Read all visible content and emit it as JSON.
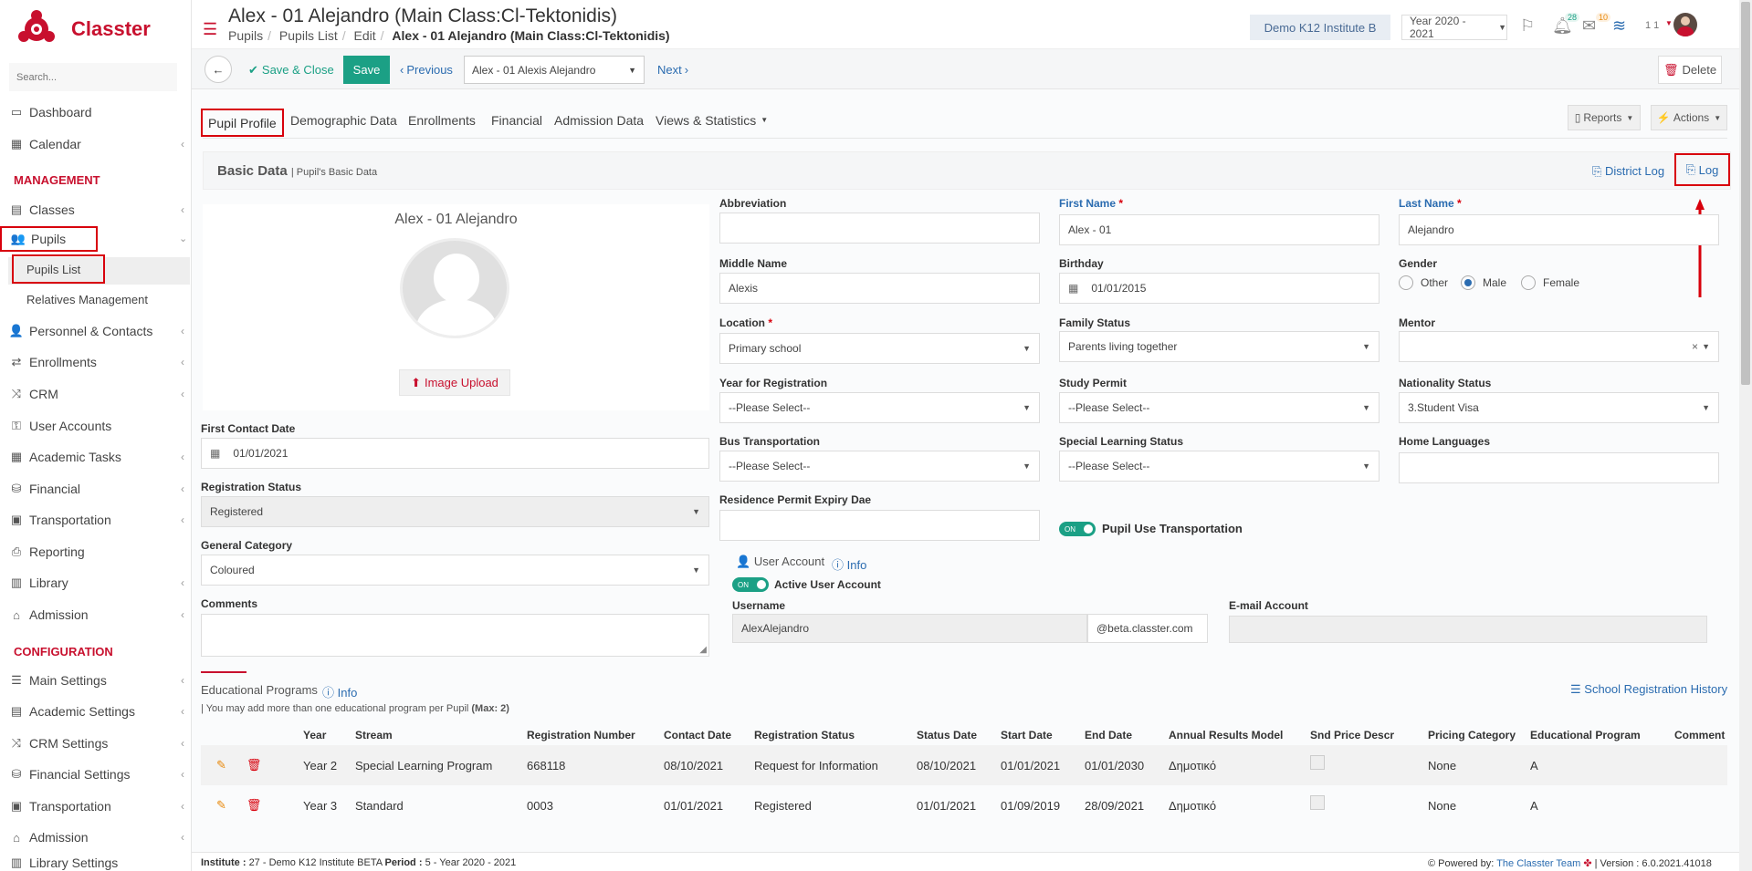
{
  "brand": {
    "name": "Classter"
  },
  "sidebar": {
    "search_placeholder": "Search...",
    "items": [
      {
        "label": "Dashboard"
      },
      {
        "label": "Calendar"
      },
      {
        "label": "Classes"
      },
      {
        "label": "Pupils"
      },
      {
        "label": "Pupils List"
      },
      {
        "label": "Relatives Management"
      },
      {
        "label": "Personnel & Contacts"
      },
      {
        "label": "Enrollments"
      },
      {
        "label": "CRM"
      },
      {
        "label": "User Accounts"
      },
      {
        "label": "Academic Tasks"
      },
      {
        "label": "Financial"
      },
      {
        "label": "Transportation"
      },
      {
        "label": "Reporting"
      },
      {
        "label": "Library"
      },
      {
        "label": "Admission"
      },
      {
        "label": "Main Settings"
      },
      {
        "label": "Academic Settings"
      },
      {
        "label": "CRM Settings"
      },
      {
        "label": "Financial Settings"
      },
      {
        "label": "Transportation"
      },
      {
        "label": "Admission"
      },
      {
        "label": "Library Settings"
      }
    ],
    "sections": {
      "management": "MANAGEMENT",
      "configuration": "CONFIGURATION"
    }
  },
  "header": {
    "title": "Alex - 01 Alejandro (Main Class:Cl-Tektonidis)",
    "breadcrumb": [
      "Pupils",
      "Pupils List",
      "Edit",
      "Alex - 01 Alejandro (Main Class:Cl-Tektonidis)"
    ],
    "institute": "Demo K12 Institute B",
    "year": "Year 2020 - 2021",
    "notif_count": "28",
    "mail_count": "10",
    "user_short": "1 1"
  },
  "toolbar": {
    "save_close": "Save & Close",
    "save": "Save",
    "previous": "Previous",
    "nav_select": "Alex - 01 Alexis Alejandro",
    "next": "Next",
    "delete": "Delete"
  },
  "tabs": [
    "Pupil Profile",
    "Demographic Data",
    "Enrollments",
    "Financial",
    "Admission Data",
    "Views & Statistics"
  ],
  "right_buttons": {
    "reports": "Reports",
    "actions": "Actions"
  },
  "basic": {
    "title": "Basic Data",
    "subtitle": "| Pupil's Basic Data",
    "district_log": "District Log",
    "log": "Log"
  },
  "profile": {
    "name": "Alex - 01 Alejandro",
    "upload": "Image Upload",
    "first_contact_label": "First Contact Date",
    "first_contact": "01/01/2021",
    "reg_status_label": "Registration Status",
    "reg_status": "Registered",
    "gen_cat_label": "General Category",
    "gen_cat": "Coloured",
    "comments_label": "Comments"
  },
  "fields": {
    "abbreviation": {
      "label": "Abbreviation",
      "value": ""
    },
    "first_name": {
      "label": "First Name",
      "value": "Alex - 01"
    },
    "last_name": {
      "label": "Last Name",
      "value": "Alejandro"
    },
    "middle_name": {
      "label": "Middle Name",
      "value": "Alexis"
    },
    "birthday": {
      "label": "Birthday",
      "value": "01/01/2015"
    },
    "gender": {
      "label": "Gender",
      "options": [
        "Other",
        "Male",
        "Female"
      ],
      "selected": "Male"
    },
    "location": {
      "label": "Location",
      "value": "Primary school"
    },
    "family_status": {
      "label": "Family Status",
      "value": "Parents living together"
    },
    "mentor": {
      "label": "Mentor",
      "value": ""
    },
    "year_reg": {
      "label": "Year for Registration",
      "value": "--Please Select--"
    },
    "study_permit": {
      "label": "Study Permit",
      "value": "--Please Select--"
    },
    "nationality": {
      "label": "Nationality Status",
      "value": "3.Student Visa"
    },
    "bus": {
      "label": "Bus Transportation",
      "value": "--Please Select--"
    },
    "special": {
      "label": "Special Learning Status",
      "value": "--Please Select--"
    },
    "home_lang": {
      "label": "Home Languages",
      "value": ""
    },
    "residence": {
      "label": "Residence Permit Expiry Dae",
      "value": ""
    },
    "pupil_transport": {
      "toggle": "ON",
      "label": "Pupil Use Transportation"
    }
  },
  "account": {
    "title": "User Account",
    "info": "Info",
    "toggle": "ON",
    "active_label": "Active User Account",
    "username_label": "Username",
    "username": "AlexAlejandro",
    "domain": "@beta.classter.com",
    "email_label": "E-mail Account",
    "email": ""
  },
  "edu": {
    "title": "Educational Programs",
    "info": "Info",
    "note": "| You may add more than one educational program per Pupil",
    "note_max": "(Max: 2)",
    "history": "School Registration History",
    "columns": [
      "Year",
      "Stream",
      "Registration Number",
      "Contact Date",
      "Registration Status",
      "Status Date",
      "Start Date",
      "End Date",
      "Annual Results Model",
      "Snd Price Descr",
      "Pricing Category",
      "Educational Program",
      "Comment"
    ],
    "rows": [
      [
        "Year 2",
        "Special Learning Program",
        "668118",
        "08/10/2021",
        "Request for Information",
        "08/10/2021",
        "01/01/2021",
        "01/01/2030",
        "Δημοτικό",
        "",
        "None",
        "A",
        ""
      ],
      [
        "Year 3",
        "Standard",
        "0003",
        "01/01/2021",
        "Registered",
        "01/01/2021",
        "01/09/2019",
        "28/09/2021",
        "Δημοτικό",
        "",
        "None",
        "A",
        ""
      ]
    ]
  },
  "footer": {
    "institute_label": "Institute :",
    "institute": "27 - Demo K12 Institute BETA",
    "period_label": "Period :",
    "period": "5 - Year 2020 - 2021",
    "powered": "Powered by:",
    "team": "The Classter Team",
    "version": "| Version : 6.0.2021.41018"
  },
  "colors": {
    "brand": "#c8102e",
    "accent": "#1ba085",
    "link": "#2b6cb0",
    "highlight": "#d8000c"
  }
}
